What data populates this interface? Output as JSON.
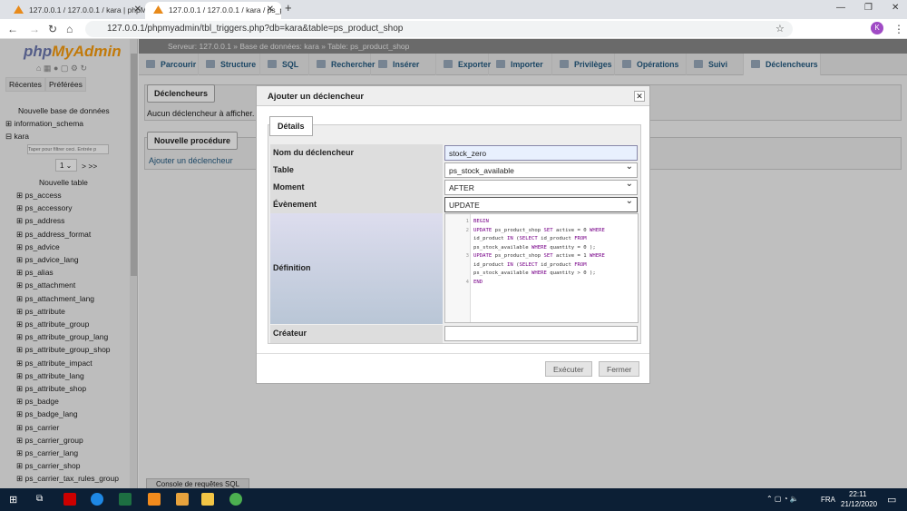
{
  "browser": {
    "tabs": [
      {
        "title": "127.0.0.1 / 127.0.0.1 / kara | phpM"
      },
      {
        "title": "127.0.0.1 / 127.0.0.1 / kara / ps_p"
      }
    ],
    "url": "127.0.0.1/phpmyadmin/tbl_triggers.php?db=kara&table=ps_product_shop"
  },
  "sidebar": {
    "logo": "phpMyAdmin",
    "recent": "Récentes",
    "favorites": "Préférées",
    "new_db": "Nouvelle base de données",
    "dbs": [
      "information_schema",
      "kara"
    ],
    "filter_placeholder": "Taper pour filtrer ceci. Entrée p",
    "page": "1",
    "page_nav": "> >>",
    "new_table": "Nouvelle table",
    "tables": [
      "ps_access",
      "ps_accessory",
      "ps_address",
      "ps_address_format",
      "ps_advice",
      "ps_advice_lang",
      "ps_alias",
      "ps_attachment",
      "ps_attachment_lang",
      "ps_attribute",
      "ps_attribute_group",
      "ps_attribute_group_lang",
      "ps_attribute_group_shop",
      "ps_attribute_impact",
      "ps_attribute_lang",
      "ps_attribute_shop",
      "ps_badge",
      "ps_badge_lang",
      "ps_carrier",
      "ps_carrier_group",
      "ps_carrier_lang",
      "ps_carrier_shop",
      "ps_carrier_tax_rules_group"
    ]
  },
  "breadcrumb": {
    "server": "Serveur: 127.0.0.1",
    "db": "Base de données: kara",
    "table": "Table: ps_product_shop"
  },
  "menu": [
    "Parcourir",
    "Structure",
    "SQL",
    "Rechercher",
    "Insérer",
    "Exporter",
    "Importer",
    "Privilèges",
    "Opérations",
    "Suivi",
    "Déclencheurs"
  ],
  "triggers": {
    "legend": "Déclencheurs",
    "none": "Aucun déclencheur à afficher.",
    "proc_legend": "Nouvelle procédure",
    "add": "Ajouter un déclencheur"
  },
  "console": "Console de requêtes SQL",
  "dialog": {
    "title": "Ajouter un déclencheur",
    "tab": "Détails",
    "fields": {
      "name_label": "Nom du déclencheur",
      "name": "stock_zero",
      "table_label": "Table",
      "table": "ps_stock_available",
      "time_label": "Moment",
      "time": "AFTER",
      "event_label": "Évènement",
      "event": "UPDATE",
      "definition_label": "Définition",
      "definer_label": "Créateur",
      "definer": ""
    },
    "code": [
      {
        "n": "1",
        "lines": [
          "BEGIN"
        ]
      },
      {
        "n": "2",
        "lines": [
          "UPDATE ps_product_shop SET active = 0 WHERE",
          "id_product IN (SELECT id_product FROM",
          "ps_stock_available WHERE quantity = 0 );"
        ]
      },
      {
        "n": "3",
        "lines": [
          "UPDATE ps_product_shop SET active = 1 WHERE",
          "id_product IN (SELECT id_product FROM",
          "ps_stock_available WHERE quantity > 0 );"
        ]
      },
      {
        "n": "4",
        "lines": [
          "END"
        ]
      }
    ],
    "execute": "Exécuter",
    "close": "Fermer"
  },
  "taskbar": {
    "lang": "FRA",
    "time": "22:11",
    "date": "21/12/2020"
  }
}
